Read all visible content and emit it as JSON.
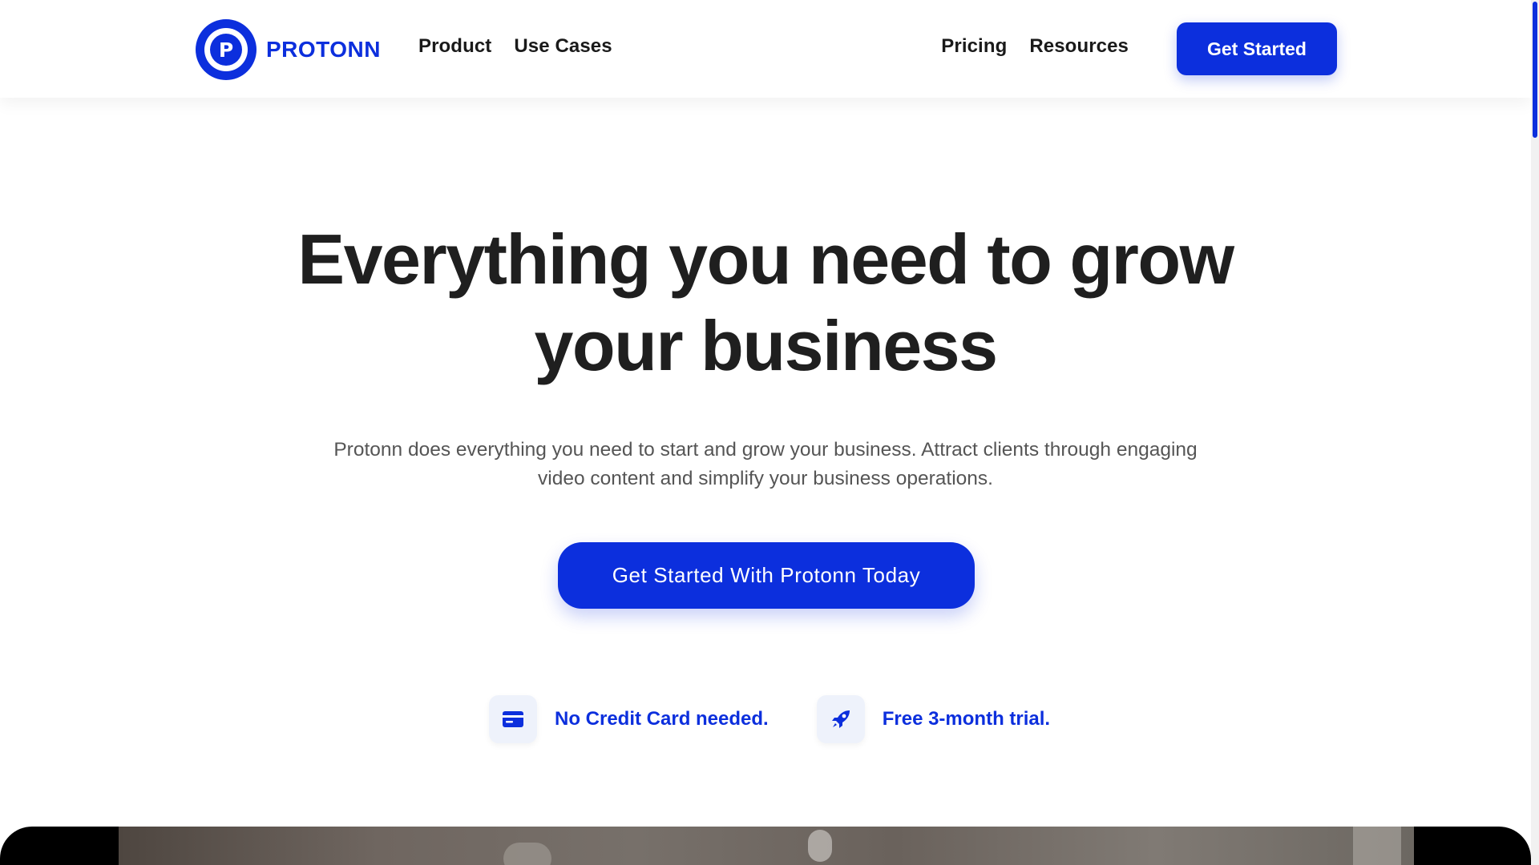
{
  "header": {
    "logo_letter": "P",
    "logo_text": "PROTONN",
    "nav_left": [
      "Product",
      "Use Cases"
    ],
    "nav_right": [
      "Pricing",
      "Resources"
    ],
    "cta_label": "Get Started"
  },
  "hero": {
    "title": "Everything you need to grow your business",
    "subtitle": "Protonn does everything you need to start and grow your business. Attract clients through engaging video content and simplify your business operations.",
    "cta_label": "Get Started With Protonn Today"
  },
  "features": [
    {
      "icon": "credit-card-icon",
      "label": "No Credit Card needed."
    },
    {
      "icon": "rocket-icon",
      "label": "Free 3-month trial."
    }
  ],
  "colors": {
    "brand": "#0c2fdd",
    "text_dark": "#1f1f1f",
    "text_muted": "#555555",
    "feature_icon_bg": "#eef2fb"
  }
}
